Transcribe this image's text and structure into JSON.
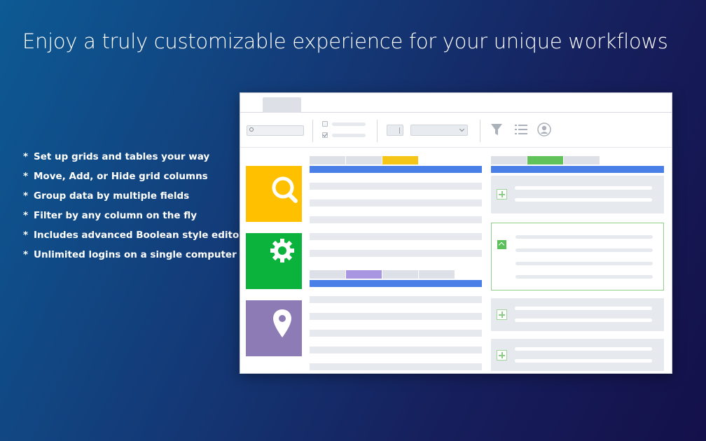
{
  "headline": "Enjoy a truly customizable experience for your unique workflows",
  "features": [
    "Set up grids and tables your way",
    "Move, Add, or Hide grid columns",
    "Group data by multiple fields",
    "Filter by any column on the fly",
    "Includes advanced Boolean style editor",
    "Unlimited logins on a single computer"
  ],
  "bullet_glyph": "*",
  "colors": {
    "accent_blue": "#4a7fe8",
    "tile_search": "#ffc000",
    "tile_settings": "#0bb33c",
    "tile_location": "#8d7bb5",
    "tab_yellow": "#f5c518",
    "tab_green": "#62c25a",
    "tab_purple": "#a896e0"
  },
  "icons": {
    "toolbar": [
      "filter-icon",
      "list-icon",
      "user-icon"
    ],
    "tiles": [
      "search-icon",
      "gear-icon",
      "location-pin-icon"
    ]
  }
}
